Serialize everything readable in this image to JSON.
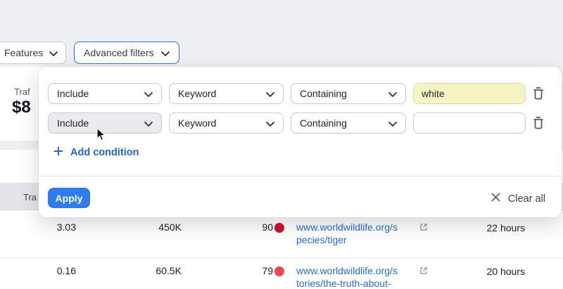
{
  "toolbar": {
    "features": {
      "label": "Features"
    },
    "advanced_filters": {
      "label": "Advanced filters"
    }
  },
  "metric_card": {
    "label_visible": "Traf",
    "value_visible": "$8"
  },
  "filter_panel": {
    "rows": [
      {
        "condition": "Include",
        "field": "Keyword",
        "operator": "Containing",
        "value": "white"
      },
      {
        "condition": "Include",
        "field": "Keyword",
        "operator": "Containing",
        "value": ""
      }
    ],
    "add_condition_label": "Add condition",
    "apply_label": "Apply",
    "clear_all_label": "Clear all"
  },
  "table": {
    "header_visible_label": "Tra",
    "rows": [
      {
        "col1": "3.03",
        "col2": "450K",
        "score": "90",
        "score_color": "#ce0d30",
        "url_line1": "www.worldwildlife.org/s",
        "url_line2": "pecies/tiger",
        "updated": "22 hours"
      },
      {
        "col1": "0.16",
        "col2": "60.5K",
        "score": "79",
        "score_color": "#f8454f",
        "url_line1": "www.worldwildlife.org/s",
        "url_line2": "tories/the-truth-about-",
        "updated": "20 hours"
      }
    ]
  },
  "colors": {
    "accent_blue": "#2e7cf2",
    "advanced_filters_border": "#2f72e8",
    "link_blue": "#2b6bd9",
    "add_condition_blue": "#2464d8",
    "highlight_yellow": "#f6f6c4",
    "score_red_dark": "#ce0d30",
    "score_red_light": "#f8454f",
    "header_row_bg": "#e3e5ea",
    "page_bg": "#eef0f3"
  }
}
